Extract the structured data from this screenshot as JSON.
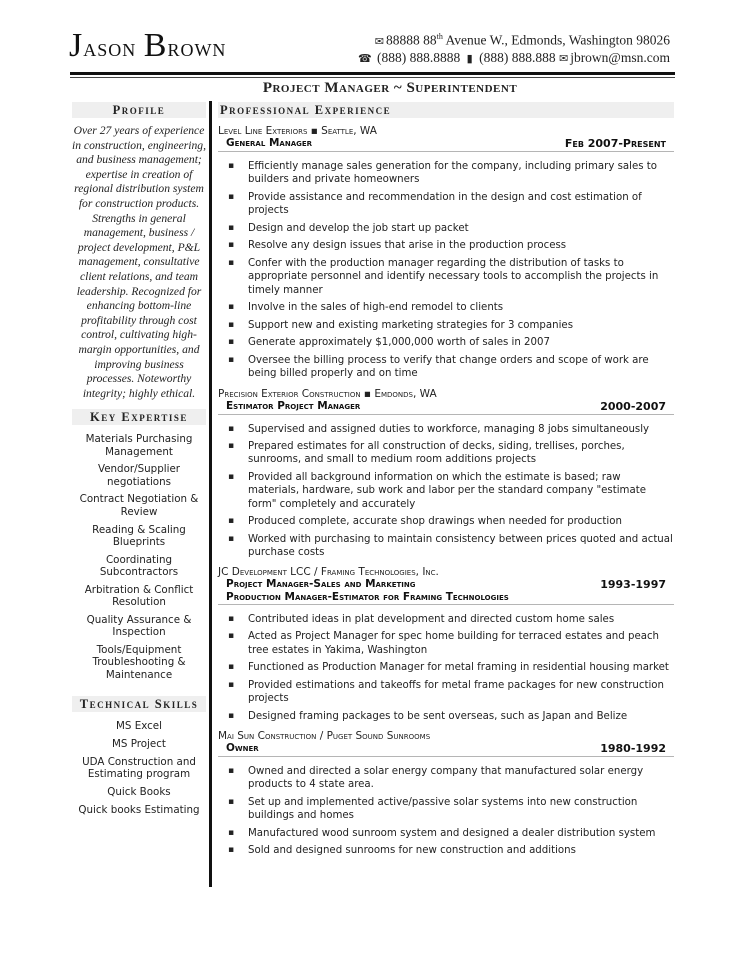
{
  "header": {
    "name_first_initial": "J",
    "name_first_rest": "ason",
    "name_last_initial": "B",
    "name_last_rest": "rown",
    "address": "88888 88",
    "address_sup": "th",
    "address_rest": " Avenue W., Edmonds, Washington 98026",
    "phone": "(888) 888.8888",
    "mobile": "(888) 888.888",
    "email": "jbrown@msn.com",
    "icons": [
      "mailbox-icon",
      "telephone-icon",
      "mobile-phone-icon",
      "envelope-icon"
    ]
  },
  "subtitle": "Project Manager ~ Superintendent",
  "left": {
    "profile_heading": "Profile",
    "profile_text": "Over 27 years of experience in construction, engineering, and business management; expertise in creation of regional distribution system for construction products. Strengths in general management, business / project development, P&L management, consultative client relations, and team leadership. Recognized for enhancing bottom-line profitability through cost control, cultivating high-margin opportunities, and improving business processes. Noteworthy integrity; highly ethical.",
    "expertise_heading": "Key Expertise",
    "expertise": [
      "Materials Purchasing Management",
      "Vendor/Supplier negotiations",
      "Contract Negotiation & Review",
      "Reading & Scaling Blueprints",
      "Coordinating Subcontractors",
      "Arbitration & Conflict Resolution",
      "Quality Assurance & Inspection",
      "Tools/Equipment Troubleshooting & Maintenance"
    ],
    "skills_heading": "Technical Skills",
    "skills": [
      "MS Excel",
      "MS Project",
      "UDA Construction and Estimating program",
      "Quick Books",
      "Quick books Estimating"
    ]
  },
  "experience": {
    "heading": "Professional Experience",
    "bullet_char": "▪",
    "jobs": [
      {
        "company": "Level Line Exteriors ▪ Seattle, WA",
        "role": "General Manager",
        "dates": "Feb 2007-Present",
        "bullets": [
          "Efficiently manage sales generation for the company, including primary sales to builders and private homeowners",
          "Provide assistance and recommendation in the design and cost estimation of projects",
          "Design and develop the job start up packet",
          "Resolve any design issues that arise in the production process",
          "Confer with the production manager regarding the distribution of tasks to appropriate personnel and identify necessary tools to accomplish the projects in timely manner",
          "Involve in the sales of high-end remodel to clients",
          "Support new and existing marketing strategies for 3 companies",
          "Generate approximately $1,000,000 worth of sales in 2007",
          "Oversee the billing process to verify that change orders and scope of work are being billed properly and on time"
        ]
      },
      {
        "company": "Precision Exterior Construction ▪ Emdonds, WA",
        "role": "Estimator Project Manager",
        "dates": "2000-2007",
        "bullets": [
          "Supervised and assigned duties to workforce, managing 8 jobs simultaneously",
          "Prepared estimates for all construction of decks, siding, trellises, porches, sunrooms, and small to medium room additions projects",
          "Provided all background information on which the estimate is based; raw materials, hardware, sub work and labor per the standard company \"estimate form\" completely and accurately",
          "Produced complete, accurate shop drawings when needed for production",
          "Worked with purchasing to maintain consistency between prices quoted and actual purchase costs"
        ]
      },
      {
        "company": "JC Development LCC / Framing Technologies, Inc.",
        "role": "Project Manager-Sales and Marketing",
        "role2": "Production Manager-Estimator for Framing Technologies",
        "dates": "1993-1997",
        "bullets": [
          "Contributed ideas in plat development and directed custom home sales",
          "Acted as Project Manager for spec home building for terraced estates and peach tree estates in Yakima, Washington",
          "Functioned as Production Manager for metal framing in residential housing market",
          "Provided estimations and takeoffs for metal frame packages for new construction projects",
          "Designed framing packages to be sent overseas, such as Japan and Belize"
        ]
      },
      {
        "company": "Mai Sun Construction / Puget Sound Sunrooms",
        "role": "Owner",
        "dates": "1980-1992",
        "bullets": [
          "Owned and directed a solar energy company that manufactured solar energy products to 4 state area.",
          "Set up and implemented active/passive solar systems into new construction buildings and homes",
          "Manufactured wood sunroom system and designed a dealer distribution system",
          "Sold and designed sunrooms for new construction and additions"
        ]
      }
    ]
  }
}
